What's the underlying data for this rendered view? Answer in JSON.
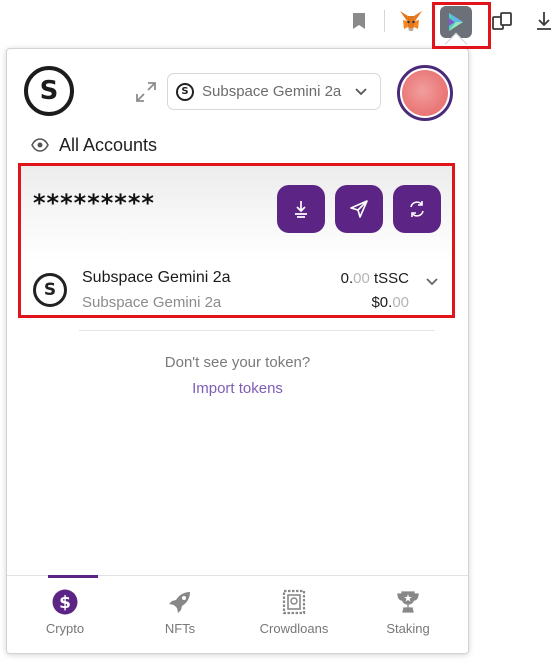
{
  "browser_toolbar": {
    "icons": [
      "bookmark-icon",
      "metamask-fox-icon",
      "subspace-extension-icon",
      "extensions-puzzle-icon",
      "download-icon"
    ]
  },
  "header": {
    "network": {
      "name": "Subspace Gemini 2a"
    },
    "accounts_label": "All Accounts"
  },
  "balance": {
    "masked_value": "*********",
    "actions": [
      {
        "name": "receive",
        "icon": "receive-icon"
      },
      {
        "name": "send",
        "icon": "send-icon"
      },
      {
        "name": "swap",
        "icon": "swap-icon"
      }
    ]
  },
  "token": {
    "name": "Subspace Gemini 2a",
    "subtitle": "Subspace Gemini 2a",
    "amount_int": "0.",
    "amount_frac": "00",
    "symbol": " tSSC",
    "fiat_int": "$0.",
    "fiat_frac": "00"
  },
  "empty_state": {
    "question": "Don't see your token?",
    "import_link": "Import tokens"
  },
  "bottom_nav": {
    "items": [
      {
        "label": "Crypto",
        "icon": "dollar-circle-icon",
        "active": true
      },
      {
        "label": "NFTs",
        "icon": "rocket-icon",
        "active": false
      },
      {
        "label": "Crowdloans",
        "icon": "stamp-icon",
        "active": false
      },
      {
        "label": "Staking",
        "icon": "trophy-icon",
        "active": false
      }
    ]
  },
  "colors": {
    "accent": "#5c2585",
    "link": "#7f5db7",
    "highlight_box": "#e0151b"
  }
}
